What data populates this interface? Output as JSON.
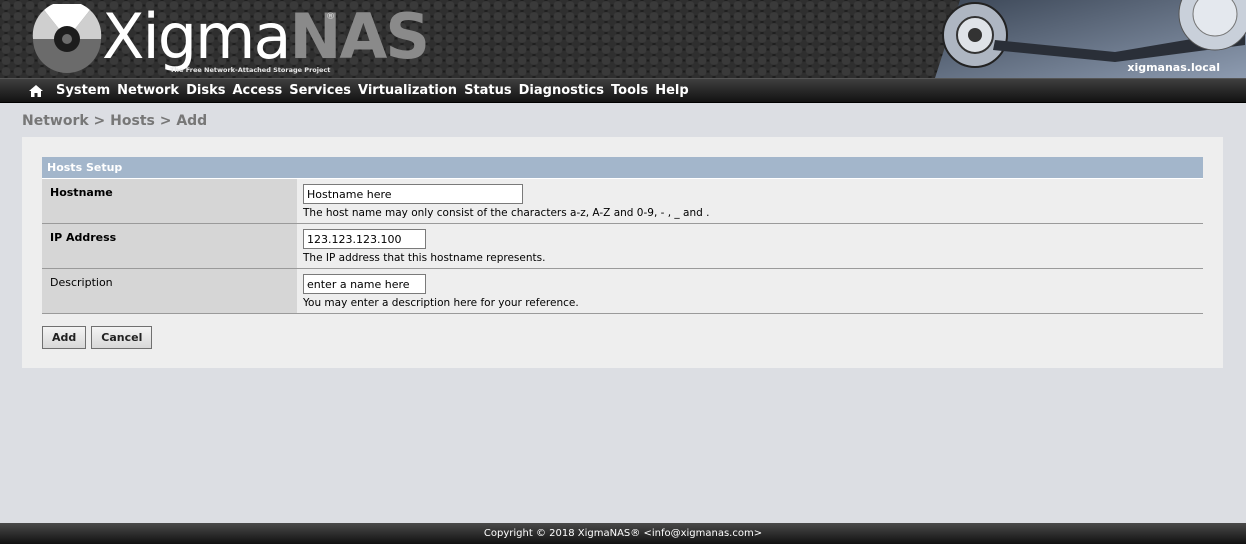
{
  "header": {
    "logo_text_1": "Xigma",
    "logo_text_2": "NAS",
    "logo_reg": "®",
    "tagline": "The Free Network-Attached Storage Project",
    "hostname": "xigmanas.local"
  },
  "nav": {
    "home_icon": "home-icon",
    "items": [
      "System",
      "Network",
      "Disks",
      "Access",
      "Services",
      "Virtualization",
      "Status",
      "Diagnostics",
      "Tools",
      "Help"
    ]
  },
  "breadcrumb": "Network > Hosts > Add",
  "form": {
    "section_title": "Hosts Setup",
    "hostname": {
      "label": "Hostname",
      "value": "Hostname here",
      "hint": "The host name may only consist of the characters a-z, A-Z and 0-9, - , _ and ."
    },
    "ip": {
      "label": "IP Address",
      "value": "123.123.123.100",
      "hint": "The IP address that this hostname represents."
    },
    "description": {
      "label": "Description",
      "value": "enter a name here",
      "hint": "You may enter a description here for your reference."
    },
    "add_label": "Add",
    "cancel_label": "Cancel"
  },
  "footer": "Copyright © 2018 XigmaNAS® <info@xigmanas.com>",
  "colors": {
    "section_header": "#a3b6cb",
    "label_bg": "#d6d6d6",
    "page_bg": "#dcdee3"
  }
}
